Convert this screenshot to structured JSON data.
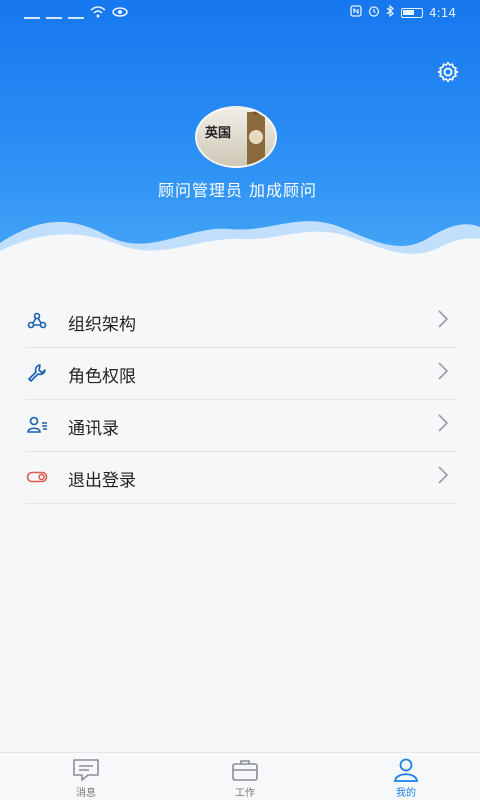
{
  "status_bar": {
    "time": "4:14"
  },
  "header": {
    "avatar_text": "英国",
    "user_name": "顾问管理员  加成顾问",
    "settings_icon": "gear-icon"
  },
  "menu": {
    "items": [
      {
        "label": "组织架构",
        "icon": "org-structure-icon"
      },
      {
        "label": "角色权限",
        "icon": "wrench-icon"
      },
      {
        "label": "通讯录",
        "icon": "contacts-icon"
      },
      {
        "label": "退出登录",
        "icon": "logout-toggle-icon"
      }
    ]
  },
  "tabbar": {
    "tabs": [
      {
        "label": "消息",
        "icon": "message-icon"
      },
      {
        "label": "工作",
        "icon": "briefcase-icon"
      },
      {
        "label": "我的",
        "icon": "person-icon",
        "active": true
      }
    ]
  },
  "colors": {
    "primary": "#1677ee",
    "active_tab": "#1c7fe8",
    "logout_icon": "#e05a4f"
  }
}
